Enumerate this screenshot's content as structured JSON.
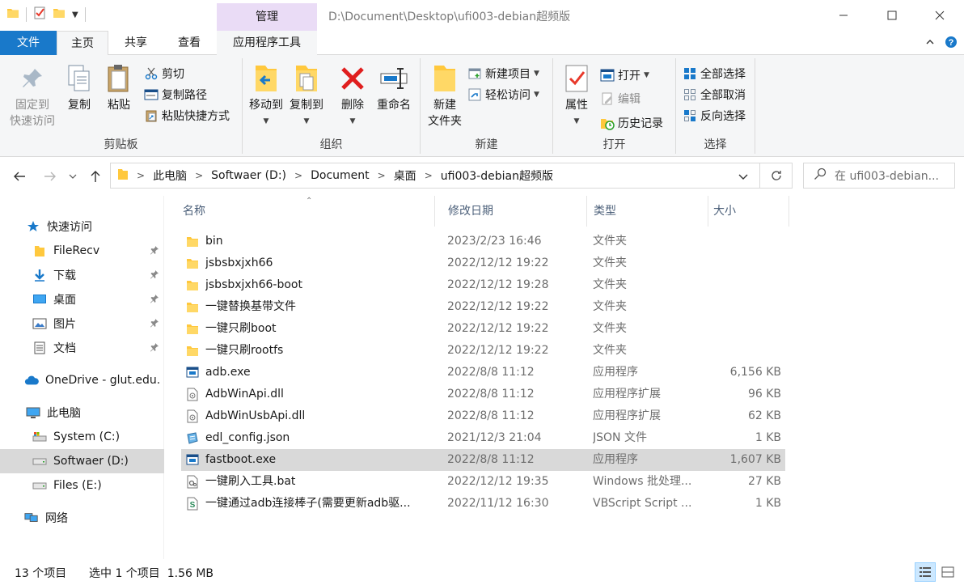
{
  "titlebar": {
    "context_tab_header": "管理",
    "path_title": "D:\\Document\\Desktop\\ufi003-debian超频版"
  },
  "ribbon_tabs": {
    "file": "文件",
    "home": "主页",
    "share": "共享",
    "view": "查看",
    "app_tools": "应用程序工具"
  },
  "ribbon": {
    "clipboard": {
      "label": "剪贴板",
      "pin_line1": "固定到",
      "pin_line2": "快速访问",
      "copy": "复制",
      "paste": "粘贴",
      "cut": "剪切",
      "copy_path": "复制路径",
      "paste_shortcut": "粘贴快捷方式"
    },
    "organize": {
      "label": "组织",
      "move_to": "移动到",
      "copy_to": "复制到",
      "delete": "删除",
      "rename": "重命名"
    },
    "new": {
      "label": "新建",
      "new_folder_line1": "新建",
      "new_folder_line2": "文件夹",
      "new_item": "新建项目",
      "easy_access": "轻松访问"
    },
    "open": {
      "label": "打开",
      "properties": "属性",
      "open": "打开",
      "edit": "编辑",
      "history": "历史记录"
    },
    "select": {
      "label": "选择",
      "select_all": "全部选择",
      "select_none": "全部取消",
      "invert": "反向选择"
    }
  },
  "address": {
    "crumbs": [
      "此电脑",
      "Softwaer (D:)",
      "Document",
      "桌面",
      "ufi003-debian超频版"
    ],
    "search_placeholder": "在 ufi003-debian..."
  },
  "nav": {
    "quick_access": "快速访问",
    "filerecv": "FileRecv",
    "downloads": "下载",
    "desktop": "桌面",
    "pictures": "图片",
    "documents": "文档",
    "onedrive": "OneDrive - glut.edu.",
    "this_pc": "此电脑",
    "drive_c": "System (C:)",
    "drive_d": "Softwaer (D:)",
    "drive_e": "Files (E:)",
    "network": "网络"
  },
  "columns": {
    "name": "名称",
    "date": "修改日期",
    "type": "类型",
    "size": "大小"
  },
  "files": [
    {
      "name": "bin",
      "date": "2023/2/23 16:46",
      "type": "文件夹",
      "size": ""
    },
    {
      "name": "jsbsbxjxh66",
      "date": "2022/12/12 19:22",
      "type": "文件夹",
      "size": ""
    },
    {
      "name": "jsbsbxjxh66-boot",
      "date": "2022/12/12 19:28",
      "type": "文件夹",
      "size": ""
    },
    {
      "name": "一键替换基带文件",
      "date": "2022/12/12 19:22",
      "type": "文件夹",
      "size": ""
    },
    {
      "name": "一键只刷boot",
      "date": "2022/12/12 19:22",
      "type": "文件夹",
      "size": ""
    },
    {
      "name": "一键只刷rootfs",
      "date": "2022/12/12 19:22",
      "type": "文件夹",
      "size": ""
    },
    {
      "name": "adb.exe",
      "date": "2022/8/8 11:12",
      "type": "应用程序",
      "size": "6,156 KB"
    },
    {
      "name": "AdbWinApi.dll",
      "date": "2022/8/8 11:12",
      "type": "应用程序扩展",
      "size": "96 KB"
    },
    {
      "name": "AdbWinUsbApi.dll",
      "date": "2022/8/8 11:12",
      "type": "应用程序扩展",
      "size": "62 KB"
    },
    {
      "name": "edl_config.json",
      "date": "2021/12/3 21:04",
      "type": "JSON 文件",
      "size": "1 KB"
    },
    {
      "name": "fastboot.exe",
      "date": "2022/8/8 11:12",
      "type": "应用程序",
      "size": "1,607 KB"
    },
    {
      "name": "一键刷入工具.bat",
      "date": "2022/12/12 19:35",
      "type": "Windows 批处理...",
      "size": "27 KB"
    },
    {
      "name": "一键通过adb连接棒子(需要更新adb驱...",
      "date": "2022/11/12 16:30",
      "type": "VBScript Script ...",
      "size": "1 KB"
    }
  ],
  "status": {
    "count": "13 个项目",
    "selection": "选中 1 个项目  1.56 MB"
  },
  "colors": {
    "file_tab": "#1979ca",
    "context_tab": "#eadcf6",
    "selection": "#d9d9d9",
    "folder": "#ffc83d"
  }
}
